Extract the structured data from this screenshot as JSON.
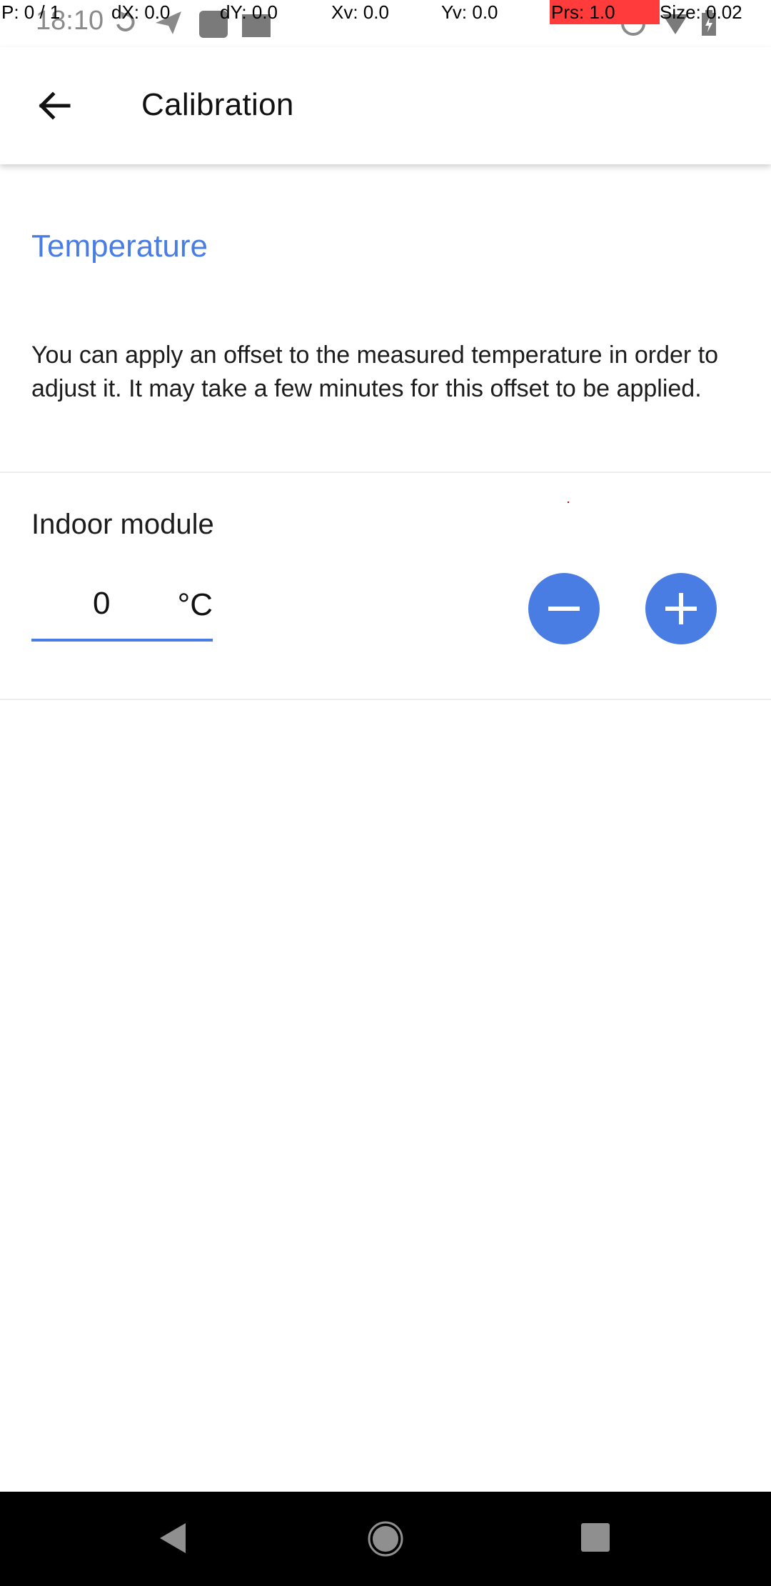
{
  "status_bar": {
    "time": "18:10",
    "icons": [
      "sync-icon",
      "send-icon",
      "square-icon",
      "image-icon",
      "circle-icon",
      "wifi-icon",
      "battery-icon"
    ]
  },
  "pointer_overlay": {
    "p": "P: 0 / 1",
    "dx": "dX: 0.0",
    "dy": "dY: 0.0",
    "xv": "Xv: 0.0",
    "yv": "Yv: 0.0",
    "prs": "Prs: 1.0",
    "size": "Size: 0.02"
  },
  "app_bar": {
    "title": "Calibration",
    "back_icon": "arrow-left-icon"
  },
  "section": {
    "title": "Temperature",
    "description": "You can apply an offset to the measured temperature in order to adjust it. It may take a few minutes for this offset to be applied."
  },
  "module": {
    "label": "Indoor module",
    "offset_value": "0",
    "unit": "°C",
    "decrement_icon": "minus-icon",
    "increment_icon": "plus-icon"
  },
  "colors": {
    "accent": "#4a7de3",
    "pressure_highlight": "#ff3b3b",
    "nav_bar": "#000000"
  },
  "nav_bar": {
    "icons": [
      "nav-back-icon",
      "nav-home-icon",
      "nav-recents-icon"
    ]
  }
}
